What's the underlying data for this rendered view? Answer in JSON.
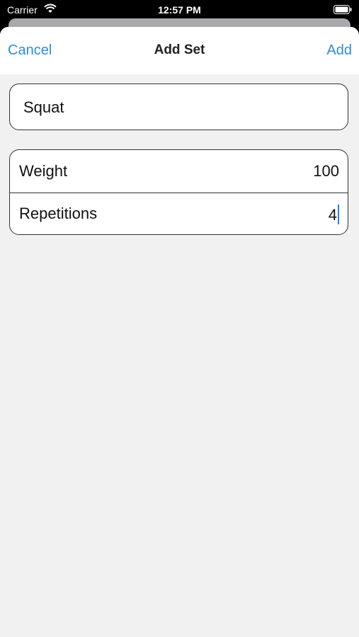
{
  "status": {
    "carrier": "Carrier",
    "time": "12:57 PM"
  },
  "nav": {
    "cancel_label": "Cancel",
    "title": "Add Set",
    "add_label": "Add"
  },
  "form": {
    "exercise_name": "Squat",
    "weight": {
      "label": "Weight",
      "value": "100"
    },
    "repetitions": {
      "label": "Repetitions",
      "value": "4"
    }
  },
  "colors": {
    "accent": "#2f8be0",
    "background": "#f1f1f2",
    "caret": "#2f7fe6"
  }
}
